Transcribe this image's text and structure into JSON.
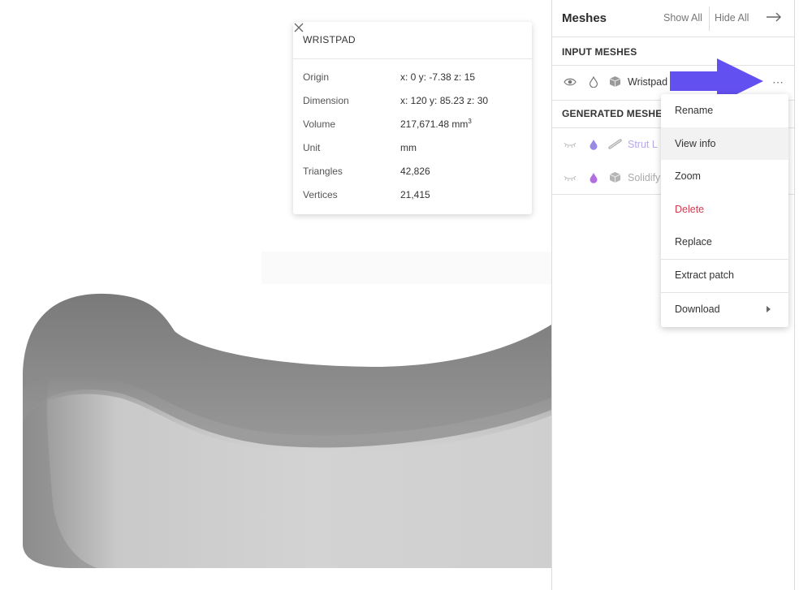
{
  "info_card": {
    "title": "WRISTPAD",
    "rows": [
      {
        "label": "Origin",
        "value": "x: 0  y: -7.38  z: 15"
      },
      {
        "label": "Dimension",
        "value": "x: 120  y: 85.23  z: 30"
      },
      {
        "label": "Volume",
        "value": "217,671.48 mm",
        "sup": "3"
      },
      {
        "label": "Unit",
        "value": "mm"
      },
      {
        "label": "Triangles",
        "value": "42,826"
      },
      {
        "label": "Vertices",
        "value": "21,415"
      }
    ]
  },
  "panel": {
    "title": "Meshes",
    "show_all": "Show All",
    "hide_all": "Hide All",
    "input_section": "INPUT MESHES",
    "generated_section": "GENERATED MESHES",
    "input_meshes": [
      {
        "name": "Wristpad",
        "visible_icon": "eye-icon",
        "drop_icon": "drop-outline-icon",
        "type_icon": "cube-icon"
      }
    ],
    "generated_meshes": [
      {
        "name": "Strut L",
        "visible_icon": "eye-closed-icon",
        "drop_icon": "drop-filled-icon",
        "type_icon": "strut-icon",
        "drop_color": "#9a8ae6"
      },
      {
        "name": "Solidify",
        "visible_icon": "eye-closed-icon",
        "drop_icon": "drop-filled-icon",
        "type_icon": "cube-icon",
        "drop_color": "#b06ee0"
      }
    ]
  },
  "context_menu": {
    "items": [
      "Rename",
      "View info",
      "Zoom",
      "Delete",
      "Replace",
      "Extract patch",
      "Download"
    ],
    "hovered": "View info",
    "danger": "Delete"
  },
  "colors": {
    "annotation_arrow": "#6350f0",
    "danger": "#d63a4f",
    "accent_purple": "#9a8ae6"
  }
}
